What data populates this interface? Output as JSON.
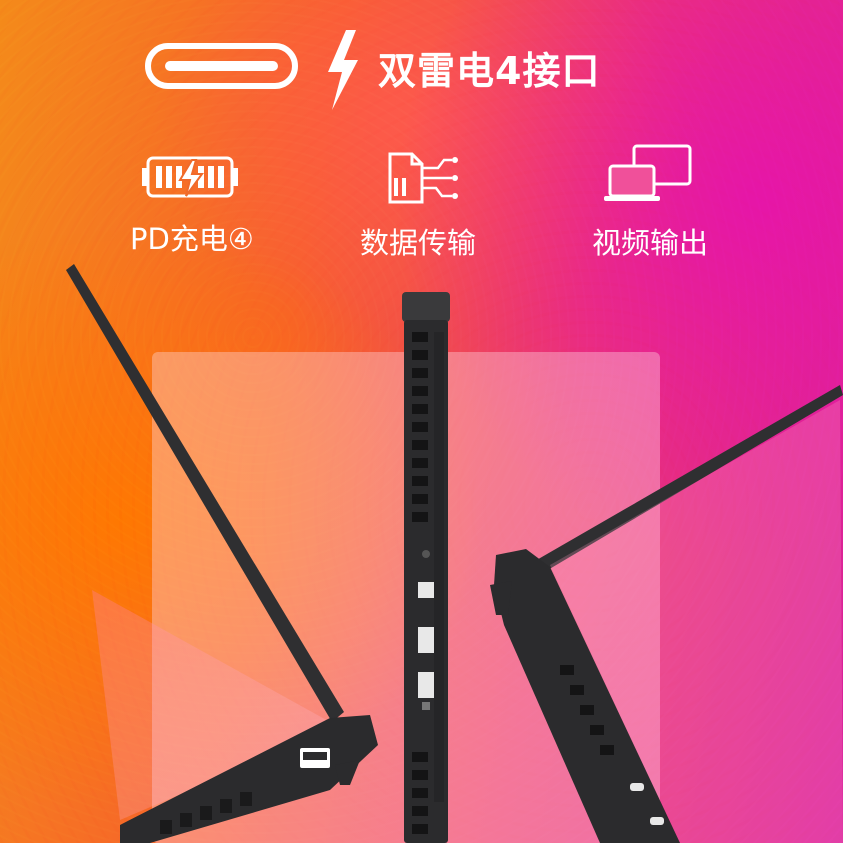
{
  "headline": "双雷电4接口",
  "features": [
    {
      "label": "PD充电④",
      "icon": "battery-charging-icon"
    },
    {
      "label": "数据传输",
      "icon": "data-transfer-icon"
    },
    {
      "label": "视频输出",
      "icon": "dual-monitor-icon"
    }
  ],
  "icons": {
    "usb_c": "usb-c-port-icon",
    "bolt": "thunderbolt-icon"
  },
  "colors": {
    "background_orange": "#f48a1a",
    "background_magenta": "#d91e9e",
    "text": "#ffffff",
    "laptop": "#2b2b2d"
  }
}
